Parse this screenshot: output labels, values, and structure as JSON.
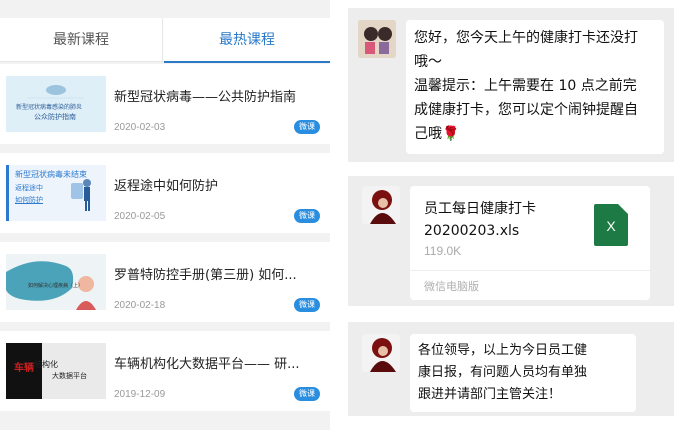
{
  "tabs": [
    "最新课程",
    "最热课程"
  ],
  "courses": [
    {
      "title": "新型冠状病毒——公共防护指南",
      "date": "2020-02-03",
      "badge": "微课",
      "thumb_caption_1": "新型冠状病毒感染的肺炎",
      "thumb_caption_2": "公众防护指南"
    },
    {
      "title": "返程途中如何防护",
      "date": "2020-02-05",
      "badge": "微课",
      "thumb_caption_1": "新型冠状病毒未结束",
      "thumb_caption_2": "返程途中",
      "thumb_caption_3": "如何防护"
    },
    {
      "title": "罗普特防控手册(第三册) 如何...",
      "date": "2020-02-18",
      "badge": "微课",
      "thumb_caption_1": "如何解决心理疾病（上）"
    },
    {
      "title": "车辆机构化大数据平台—— 研...",
      "date": "2019-12-09",
      "badge": "微课",
      "thumb_caption_1": "结构化",
      "thumb_caption_2": "大数据平台",
      "thumb_mark": "车辆"
    }
  ],
  "chat": {
    "message_1_line_1": "您好，您今天上午的健康打卡还没打",
    "message_1_line_2": "哦～",
    "message_1_line_3": "温馨提示：上午需要在 10 点之前完",
    "message_1_line_4": "成健康打卡，您可以定个闹钟提醒自",
    "message_1_line_5": "己哦",
    "rose_emoji": "🌹",
    "file_name_line_1": "员工每日健康打卡",
    "file_name_line_2": "20200203.xls",
    "file_size": "119.0K",
    "file_source": "微信电脑版",
    "file_icon_letter": "X",
    "message_2_line_1": "各位领导，以上为今日员工健",
    "message_2_line_2": "康日报，有问题人员均有单独",
    "message_2_line_3": "跟进并请部门主管关注！"
  },
  "colors": {
    "accent": "#2a7ac8",
    "badge": "#2a8ee0",
    "excel": "#1d7a44",
    "chat_bg": "#ededed"
  }
}
